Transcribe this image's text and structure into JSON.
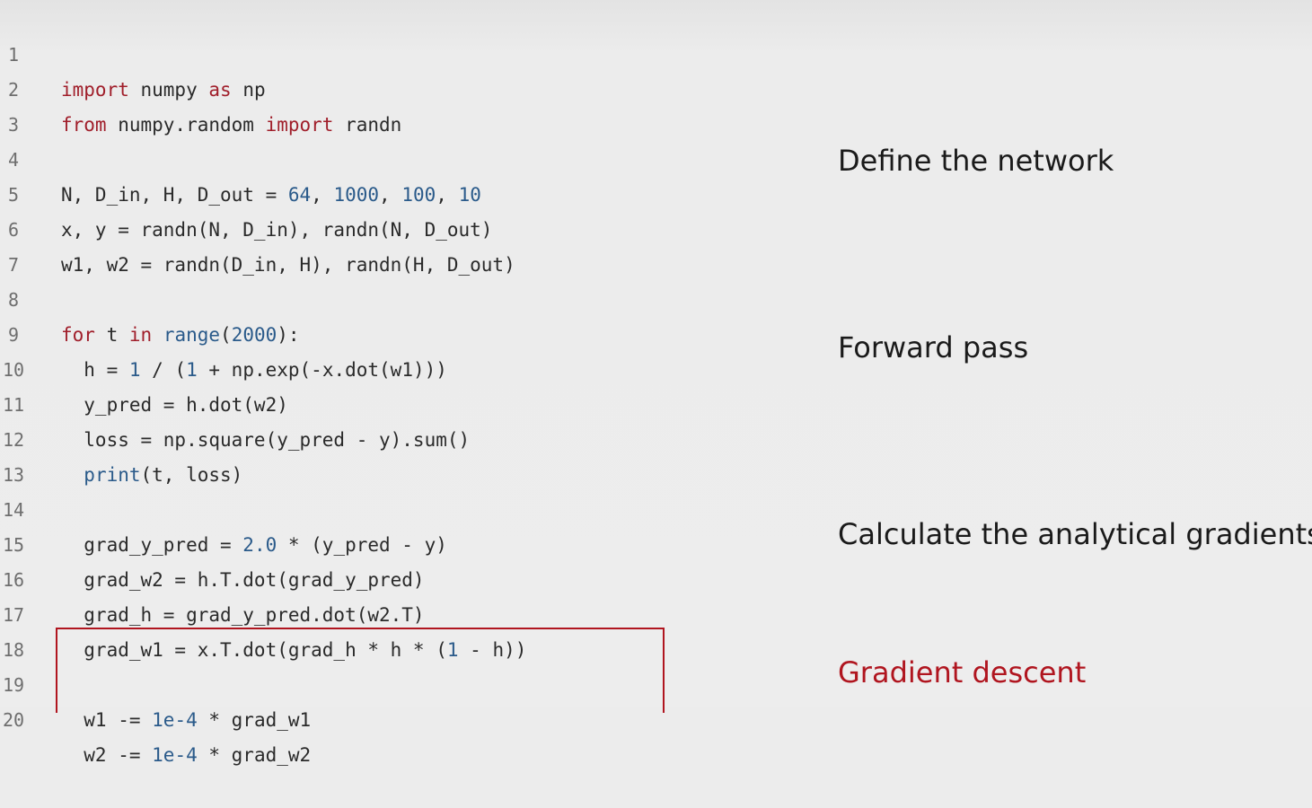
{
  "code": {
    "lines": [
      {
        "n": "1",
        "text": "import numpy as np"
      },
      {
        "n": "2",
        "text": "from numpy.random import randn"
      },
      {
        "n": "3",
        "text": ""
      },
      {
        "n": "4",
        "text": "N, D_in, H, D_out = 64, 1000, 100, 10"
      },
      {
        "n": "5",
        "text": "x, y = randn(N, D_in), randn(N, D_out)"
      },
      {
        "n": "6",
        "text": "w1, w2 = randn(D_in, H), randn(H, D_out)"
      },
      {
        "n": "7",
        "text": ""
      },
      {
        "n": "8",
        "text": "for t in range(2000):"
      },
      {
        "n": "9",
        "text": "  h = 1 / (1 + np.exp(-x.dot(w1)))"
      },
      {
        "n": "10",
        "text": "  y_pred = h.dot(w2)"
      },
      {
        "n": "11",
        "text": "  loss = np.square(y_pred - y).sum()"
      },
      {
        "n": "12",
        "text": "  print(t, loss)"
      },
      {
        "n": "13",
        "text": ""
      },
      {
        "n": "14",
        "text": "  grad_y_pred = 2.0 * (y_pred - y)"
      },
      {
        "n": "15",
        "text": "  grad_w2 = h.T.dot(grad_y_pred)"
      },
      {
        "n": "16",
        "text": "  grad_h = grad_y_pred.dot(w2.T)"
      },
      {
        "n": "17",
        "text": "  grad_w1 = x.T.dot(grad_h * h * (1 - h))"
      },
      {
        "n": "18",
        "text": ""
      },
      {
        "n": "19",
        "text": "  w1 -= 1e-4 * grad_w1"
      },
      {
        "n": "20",
        "text": "  w2 -= 1e-4 * grad_w2"
      }
    ]
  },
  "annotations": {
    "define": "Define the network",
    "forward": "Forward pass",
    "gradients": "Calculate the analytical gradients",
    "descent": "Gradient descent"
  },
  "colors": {
    "accent": "#b0151f",
    "background": "#ececec"
  }
}
